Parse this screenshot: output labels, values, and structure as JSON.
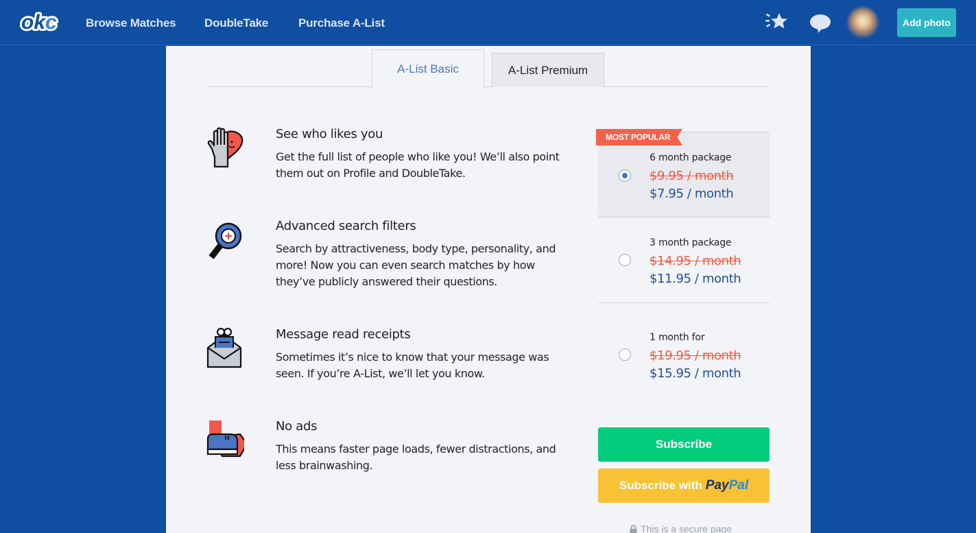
{
  "topnav": {
    "logo_text": "okc",
    "links": [
      "Browse Matches",
      "DoubleTake",
      "Purchase A-List"
    ],
    "icons": [
      "star-icon",
      "message-icon"
    ],
    "add_photo_label": "Add photo"
  },
  "tabs": [
    {
      "label": "A-List Basic",
      "active": true
    },
    {
      "label": "A-List Premium",
      "active": false
    }
  ],
  "features": [
    {
      "icon": "hand-heart-icon",
      "title": "See who likes you",
      "description": "Get the full list of people who like you! We’ll also point them out on Profile and DoubleTake."
    },
    {
      "icon": "magnifier-icon",
      "title": "Advanced search filters",
      "description": "Search by attractiveness, body type, personality, and more! Now you can even search matches by how they’ve publicly answered their questions."
    },
    {
      "icon": "envelope-eyes-icon",
      "title": "Message read receipts",
      "description": "Sometimes it’s nice to know that your message was seen. If you’re A-List, we’ll let you know."
    },
    {
      "icon": "shoe-kick-icon",
      "title": "No ads",
      "description": "This means faster page loads, fewer distractions, and less brainwashing."
    }
  ],
  "plans": {
    "badge": "MOST POPULAR",
    "options": [
      {
        "name": "6 month package",
        "old_price": "$9.95 / month",
        "new_price": "$7.95 / month",
        "selected": true
      },
      {
        "name": "3 month package",
        "old_price": "$14.95 / month",
        "new_price": "$11.95 / month",
        "selected": false
      },
      {
        "name": "1 month for",
        "old_price": "$19.95 / month",
        "new_price": "$15.95 / month",
        "selected": false
      }
    ]
  },
  "actions": {
    "subscribe_label": "Subscribe",
    "paypal_prefix": "Subscribe with",
    "paypal_brand_1": "Pay",
    "paypal_brand_2": "Pal",
    "secure_text": "This is a secure page"
  },
  "colors": {
    "brand_blue": "#0f4ea1",
    "subscribe_green": "#03cd7c",
    "paypal_yellow": "#f8c234",
    "badge_red": "#f2624b",
    "old_price_red": "#f05a3f",
    "new_price_blue": "#244e98",
    "add_photo_teal": "#2eb3c4"
  }
}
